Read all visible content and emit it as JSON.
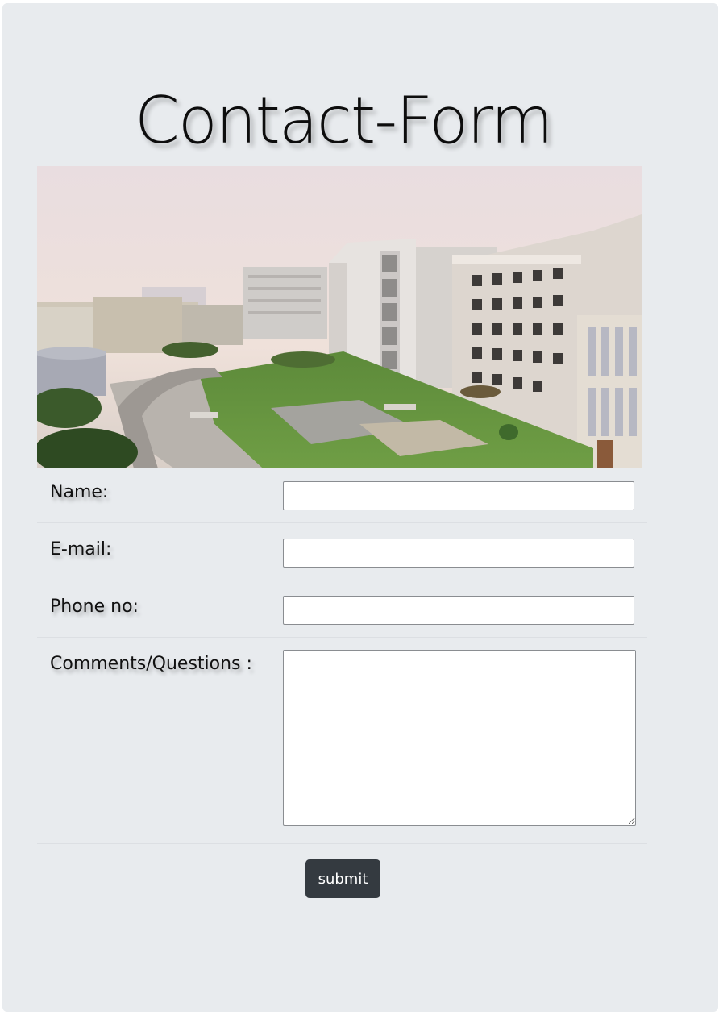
{
  "page": {
    "title": "Contact-Form"
  },
  "photo": {
    "subject": "campus-buildings-photo"
  },
  "form": {
    "name_label": "Name:",
    "name_value": "",
    "email_label": "E-mail:",
    "email_value": "",
    "phone_label": "Phone no:",
    "phone_value": "",
    "comments_label": "Comments/Questions :",
    "comments_value": "",
    "submit_label": "submit"
  },
  "colors": {
    "card_background": "#e8ebee",
    "button_background": "#343a40",
    "button_text": "#ffffff"
  }
}
